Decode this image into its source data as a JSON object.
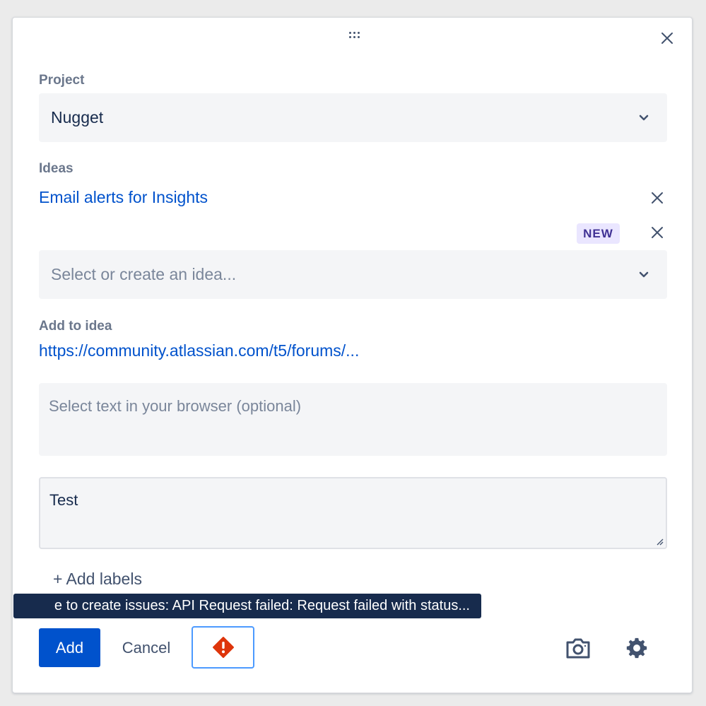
{
  "project": {
    "label": "Project",
    "value": "Nugget"
  },
  "ideas": {
    "label": "Ideas",
    "selected": "Email alerts for Insights",
    "new_badge": "NEW",
    "placeholder": "Select or create an idea..."
  },
  "add_to_idea": {
    "label": "Add to idea",
    "url": "https://community.atlassian.com/t5/forums/..."
  },
  "selection_field": {
    "placeholder": "Select text in your browser (optional)"
  },
  "note_field": {
    "value": "Test"
  },
  "add_labels": "+ Add labels",
  "error_tooltip": "e to create issues: API Request failed: Request failed with status...",
  "footer": {
    "add": "Add",
    "cancel": "Cancel"
  },
  "icons": {
    "close": "close-icon",
    "drag": "drag-handle-icon",
    "chevron": "chevron-down-icon",
    "error": "error-icon",
    "camera": "camera-icon",
    "settings": "gear-icon"
  },
  "colors": {
    "primary": "#0052cc",
    "link": "#0052cc",
    "error": "#de350b",
    "badge_bg": "#eae6ff",
    "badge_text": "#403294",
    "tooltip_bg": "#172b4d"
  }
}
